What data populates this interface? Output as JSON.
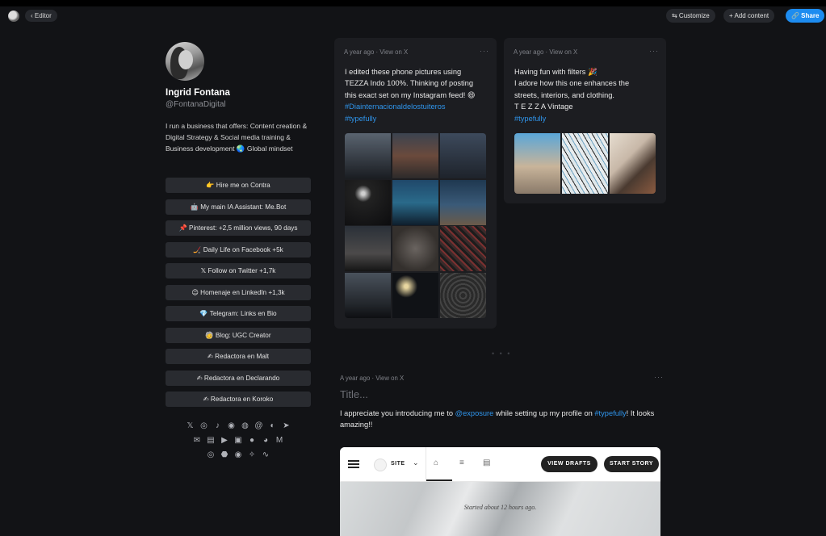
{
  "topbar": {
    "editor_label": "‹  Editor",
    "customize_label": "⇆  Customize",
    "add_content_label": "+  Add content",
    "share_label": "🔗 Share"
  },
  "profile": {
    "name": "Ingrid Fontana",
    "handle": "@FontanaDigital",
    "bio": "I run a business that offers: Content creation & Digital Strategy & Social media training & Business development 🌏 Global mindset",
    "links": [
      "👉 Hire me on Contra",
      "🤖 My main IA Assistant: Me.Bot",
      "📌 Pinterest: +2,5 million views, 90 days",
      "🏒 Daily Life on Facebook +5k",
      "𝕏  Follow on Twitter +1,7k",
      "😉 Homenaje en LinkedIn +1,3k",
      "💎 Telegram: Links en Bio",
      "🧓 Blog: UGC Creator",
      "✍ Redactora en Malt",
      "✍ Redactora en Declarando",
      "✍ Redactora en Koroko"
    ],
    "social_rows": [
      [
        "𝕏",
        "◎",
        "♪",
        "◉",
        "◍",
        "@",
        "◐",
        "➤"
      ],
      [
        "✉",
        "▤",
        "▶",
        "▣",
        "●",
        "◕",
        "M"
      ],
      [
        "◎",
        "⬣",
        "◉",
        "✧",
        "∿"
      ]
    ]
  },
  "post1": {
    "meta": "A year ago · View on X",
    "more": "···",
    "lines": [
      "I edited these phone pictures using",
      "TEZZA Indo 100%. Thinking of posting",
      "this exact set on my Instagram feed! 😄"
    ],
    "hashtag1": "#Diainternacionaldelostuiteros",
    "hashtag2": "#typefully"
  },
  "post2": {
    "meta": "A year ago · View on X",
    "more": "···",
    "lines": [
      "Having fun with filters 🎉",
      "I adore how this one enhances the",
      "streets, interiors, and clothing.",
      "T E Z Z A Vintage"
    ],
    "hashtag": "#typefully"
  },
  "separator": "• • •",
  "post3": {
    "meta": "A year ago · View on X",
    "more": "···",
    "title_placeholder": "Title...",
    "text_before": "I appreciate you introducing me to ",
    "mention": "@exposure",
    "text_middle": " while setting up my profile on ",
    "hashtag": "#typefully",
    "text_after": "! It looks amazing!!",
    "embed": {
      "site_label": "SITE",
      "view_drafts": "VIEW DRAFTS",
      "start_story": "START STORY",
      "started": "Started about 12 hours ago."
    }
  },
  "colors": {
    "accent": "#1d8cf0",
    "link": "#2f95ec",
    "background": "#121316",
    "card": "#1c1d21"
  }
}
